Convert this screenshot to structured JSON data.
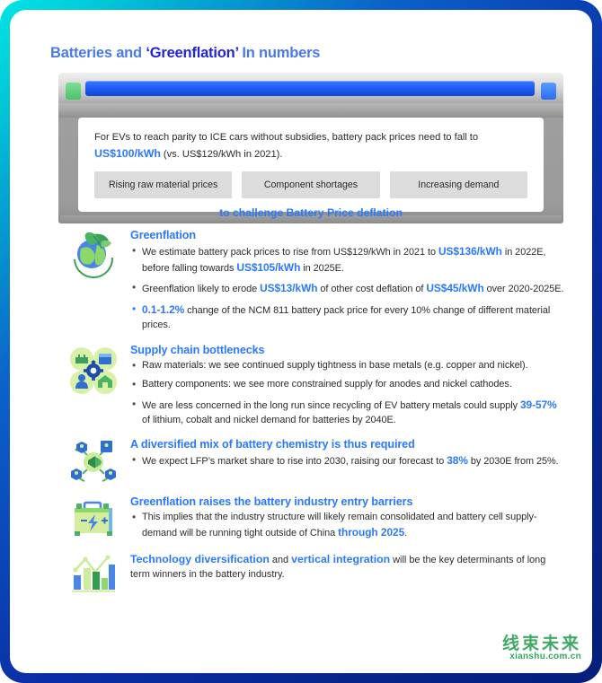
{
  "title": {
    "part1": "Batteries and ",
    "part2": "‘Greenflation’",
    "part3": " In numbers"
  },
  "hero": {
    "lead_pre": "For EVs to reach parity to ICE cars without subsidies, battery pack prices need to fall to ",
    "lead_hl": "US$100/kWh",
    "lead_post": " (vs. US$129/kWh in 2021).",
    "chips": [
      "Rising raw material prices",
      "Component shortages",
      "Increasing demand"
    ],
    "footer": "to challenge Battery Price deflation"
  },
  "sections": [
    {
      "icon": "green-earth-leaf-icon",
      "heading": "Greenflation",
      "bullets": [
        {
          "blue_bullet": false,
          "parts": [
            {
              "t": "We estimate battery pack prices to rise from US$129/kWh in 2021 to ",
              "hl": false
            },
            {
              "t": "US$136/kWh",
              "hl": true
            },
            {
              "t": " in 2022E, before falling towards ",
              "hl": false
            },
            {
              "t": "US$105/kWh",
              "hl": true
            },
            {
              "t": " in 2025E.",
              "hl": false
            }
          ]
        },
        {
          "blue_bullet": false,
          "parts": [
            {
              "t": "Greenflation likely to erode ",
              "hl": false
            },
            {
              "t": "US$13/kWh",
              "hl": true
            },
            {
              "t": " of other cost deflation of ",
              "hl": false
            },
            {
              "t": "US$45/kWh",
              "hl": true
            },
            {
              "t": " over 2020-2025E.",
              "hl": false
            }
          ]
        },
        {
          "blue_bullet": true,
          "parts": [
            {
              "t": "0.1-1.2%",
              "hl": true
            },
            {
              "t": " change of the NCM 811 battery pack price for every 10% change of different material prices.",
              "hl": false
            }
          ]
        }
      ]
    },
    {
      "icon": "supply-chain-gear-icon",
      "heading": "Supply chain bottlenecks",
      "bullets": [
        {
          "blue_bullet": false,
          "parts": [
            {
              "t": "Raw materials: we see continued supply tightness in base metals (e.g. copper and nickel).",
              "hl": false
            }
          ]
        },
        {
          "blue_bullet": false,
          "parts": [
            {
              "t": "Battery components: we see more constrained supply for anodes and nickel cathodes.",
              "hl": false
            }
          ]
        },
        {
          "blue_bullet": false,
          "parts": [
            {
              "t": "We are less concerned in the long run since recycling of EV battery metals could supply ",
              "hl": false
            },
            {
              "t": "39-57%",
              "hl": true
            },
            {
              "t": " of lithium, cobalt and nickel demand for batteries by 2040E.",
              "hl": false
            }
          ]
        }
      ]
    },
    {
      "icon": "network-megaphone-icon",
      "heading": "A diversified mix of battery chemistry is thus required",
      "bullets": [
        {
          "blue_bullet": false,
          "parts": [
            {
              "t": "We expect LFP’s market share to rise into 2030, raising our forecast to ",
              "hl": false
            },
            {
              "t": "38%",
              "hl": true
            },
            {
              "t": " by 2030E from 25%.",
              "hl": false
            }
          ]
        }
      ]
    },
    {
      "icon": "car-battery-icon",
      "heading": "Greenflation raises the battery industry entry barriers",
      "bullets": [
        {
          "blue_bullet": false,
          "parts": [
            {
              "t": "This implies that the industry structure will likely remain consolidated and battery cell supply-demand will be running tight outside of China ",
              "hl": false
            },
            {
              "t": "through 2025",
              "hl": true
            },
            {
              "t": ".",
              "hl": false
            }
          ]
        }
      ]
    },
    {
      "icon": "bar-line-chart-icon",
      "heading": "",
      "paragraph": [
        {
          "t": "Technology diversification",
          "hl": true
        },
        {
          "t": " and ",
          "hl": false
        },
        {
          "t": "vertical integration",
          "hl": true
        },
        {
          "t": " will be the key determinants of long term winners in the battery industry.",
          "hl": false
        }
      ]
    }
  ],
  "watermark": {
    "cn": "线束未来",
    "url": "xianshu.com.cn"
  },
  "colors": {
    "accent_blue": "#2979ff",
    "title_blue": "#4a7ae8",
    "title_indigo": "#2323d8",
    "chip_gray": "#dcdcdc",
    "watermark_green": "#1f9c4a"
  }
}
